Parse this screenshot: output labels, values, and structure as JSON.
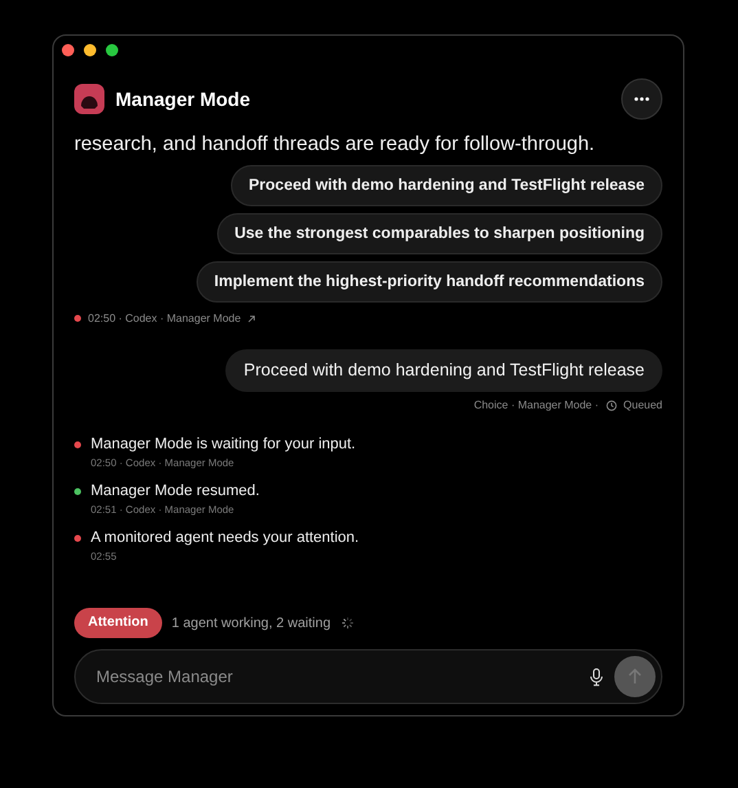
{
  "window": {
    "title": "Manager Mode"
  },
  "intro": "research, and handoff threads are ready for follow-through.",
  "choices": [
    {
      "label": "Proceed with demo hardening and TestFlight release"
    },
    {
      "label": "Use the strongest comparables to sharpen positioning"
    },
    {
      "label": "Implement the highest-priority handoff recommendations"
    }
  ],
  "choice_meta": {
    "color": "#e5484d",
    "text": "02:50 · Codex · Manager Mode"
  },
  "user_message": {
    "text": "Proceed with demo hardening and TestFlight release",
    "meta": "Choice · Manager Mode ·",
    "status": "Queued"
  },
  "events": [
    {
      "color": "#e5484d",
      "title": "Manager Mode is waiting for your input.",
      "meta": "02:50 · Codex · Manager Mode"
    },
    {
      "color": "#4cc261",
      "title": "Manager Mode resumed.",
      "meta": "02:51 · Codex · Manager Mode"
    },
    {
      "color": "#e5484d",
      "title": "A monitored agent needs your attention.",
      "meta": "02:55"
    }
  ],
  "status": {
    "badge": "Attention",
    "text": "1 agent working, 2 waiting"
  },
  "composer": {
    "placeholder": "Message Manager"
  }
}
